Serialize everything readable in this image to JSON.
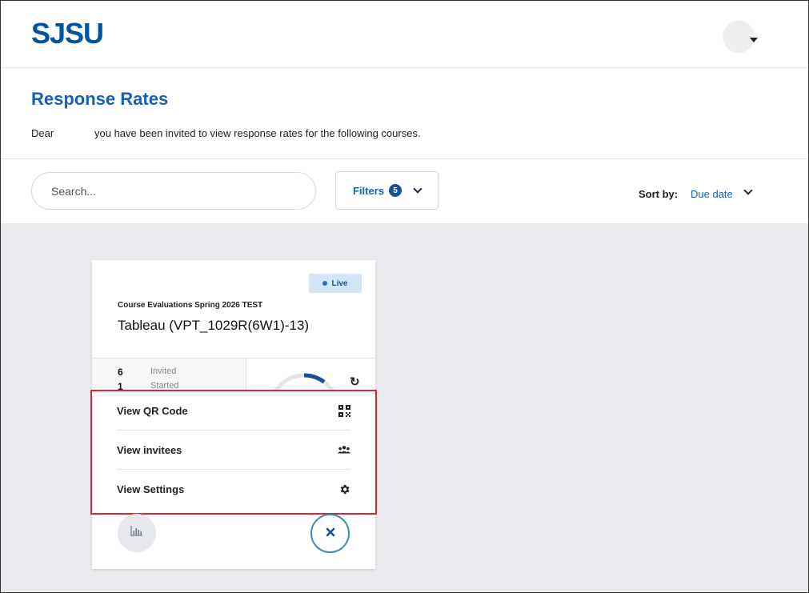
{
  "header": {
    "logo": "SJSU",
    "avatar_icon": "user-avatar"
  },
  "page": {
    "title": "Response Rates",
    "dear": "Dear",
    "invite_text": "you have been invited to view response rates for the following courses."
  },
  "toolbar": {
    "search_placeholder": "Search...",
    "filters_label": "Filters",
    "filters_count": "5",
    "sort_label": "Sort by:",
    "sort_value": "Due date"
  },
  "card": {
    "status": "Live",
    "subtitle": "Course Evaluations Spring 2026 TEST",
    "title": "Tableau (VPT_1029R(6W1)-13)",
    "stats": [
      {
        "value": "6",
        "label": "Invited"
      },
      {
        "value": "1",
        "label": "Started"
      }
    ],
    "gauge_fill": 0.17,
    "refresh_icon": "refresh-icon",
    "chart_icon": "bar-chart-icon",
    "close_icon": "close-icon"
  },
  "menu": {
    "items": [
      {
        "label": "View QR Code",
        "icon": "qr-code-icon"
      },
      {
        "label": "View invitees",
        "icon": "users-icon"
      },
      {
        "label": "View Settings",
        "icon": "gear-icon"
      }
    ]
  },
  "colors": {
    "brand": "#0055a2",
    "accent": "#1a5fb4",
    "highlight": "#e1232b",
    "close_ring": "#3f8dad"
  }
}
